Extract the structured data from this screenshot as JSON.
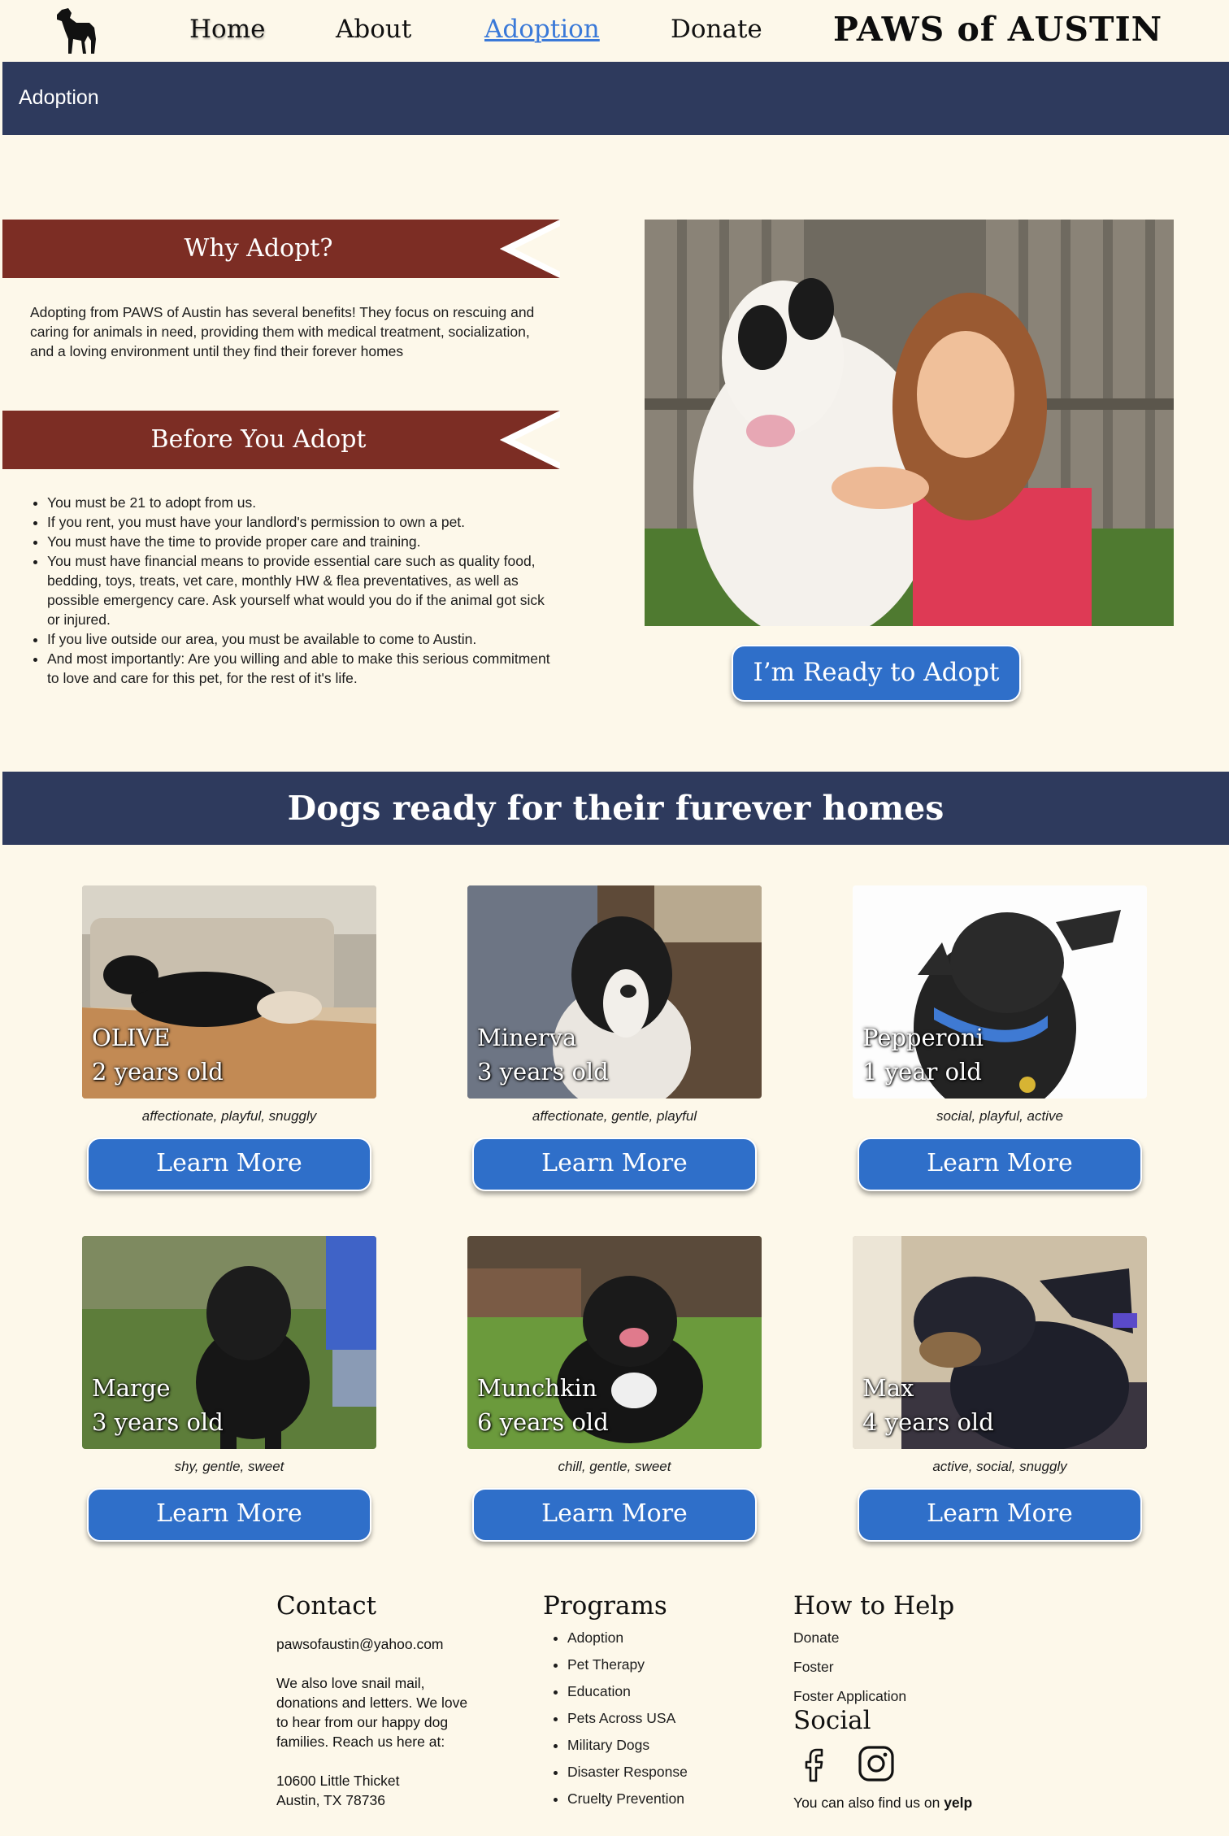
{
  "nav": {
    "home": "Home",
    "about": "About",
    "adoption": "Adoption",
    "donate": "Donate",
    "brand": "PAWS of AUSTIN"
  },
  "page_title": "Adoption",
  "why": {
    "heading": "Why Adopt?",
    "text": "Adopting from PAWS of Austin has several benefits! They focus on rescuing and caring for animals in need, providing them with medical treatment, socialization, and a loving environment until they find their forever homes"
  },
  "before": {
    "heading": "Before You Adopt",
    "items": [
      "You must be 21 to adopt from us.",
      "If you rent, you must have your landlord's permission to own a pet.",
      "You must have the time to provide proper care and training.",
      "You must have financial means to provide essential care such as quality food, bedding, toys, treats, vet care, monthly HW & flea preventatives, as well as possible emergency care. Ask yourself what would you do if the animal got sick or injured.",
      "If you live outside our area, you must be available to come to Austin.",
      "And most importantly: Are you willing and able to make this serious commitment to love and care for this pet, for the rest of it's life."
    ]
  },
  "ready_button": "I’m Ready to Adopt",
  "dogs_heading": "Dogs ready for their furever homes",
  "dogs": [
    {
      "name": "OLIVE",
      "age": "2 years old",
      "traits": "affectionate, playful, snuggly",
      "button": "Learn More"
    },
    {
      "name": "Minerva",
      "age": "3 years old",
      "traits": "affectionate, gentle, playful",
      "button": "Learn More"
    },
    {
      "name": "Pepperoni",
      "age": "1 year old",
      "traits": "social, playful, active",
      "button": "Learn More"
    },
    {
      "name": "Marge",
      "age": "3 years old",
      "traits": "shy, gentle, sweet",
      "button": "Learn More"
    },
    {
      "name": "Munchkin",
      "age": "6 years old",
      "traits": "chill, gentle, sweet",
      "button": "Learn More"
    },
    {
      "name": "Max",
      "age": "4 years old",
      "traits": "active, social, snuggly",
      "button": "Learn More"
    }
  ],
  "footer": {
    "contact_heading": "Contact",
    "email": "pawsofaustin@yahoo.com",
    "mail_text": "We also love snail mail, donations and letters. We love to hear from our happy dog families. Reach us here at:",
    "address1": "10600 Little Thicket",
    "address2": "Austin, TX 78736",
    "programs_heading": "Programs",
    "programs": [
      "Adoption",
      "Pet Therapy",
      "Education",
      "Pets Across USA",
      "Military Dogs",
      "Disaster Response",
      "Cruelty Prevention"
    ],
    "help_heading": "How to Help",
    "help_links": [
      "Donate",
      "Foster",
      "Foster Application"
    ],
    "social_heading": "Social",
    "yelp_prefix": "You can also find us on",
    "yelp": "yelp",
    "icons": [
      "facebook-icon",
      "instagram-icon"
    ]
  },
  "colors": {
    "background": "#fdf8ea",
    "navy": "#2e3a5d",
    "ribbon": "#7c2d24",
    "button_blue": "#2f6fc9",
    "active_link": "#3a79d8"
  }
}
